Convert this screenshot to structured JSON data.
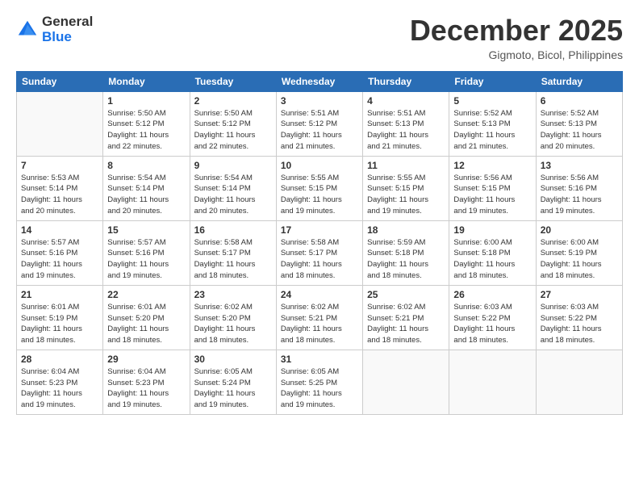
{
  "logo": {
    "general": "General",
    "blue": "Blue"
  },
  "title": "December 2025",
  "location": "Gigmoto, Bicol, Philippines",
  "weekdays": [
    "Sunday",
    "Monday",
    "Tuesday",
    "Wednesday",
    "Thursday",
    "Friday",
    "Saturday"
  ],
  "weeks": [
    [
      {
        "day": "",
        "info": ""
      },
      {
        "day": "1",
        "info": "Sunrise: 5:50 AM\nSunset: 5:12 PM\nDaylight: 11 hours\nand 22 minutes."
      },
      {
        "day": "2",
        "info": "Sunrise: 5:50 AM\nSunset: 5:12 PM\nDaylight: 11 hours\nand 22 minutes."
      },
      {
        "day": "3",
        "info": "Sunrise: 5:51 AM\nSunset: 5:12 PM\nDaylight: 11 hours\nand 21 minutes."
      },
      {
        "day": "4",
        "info": "Sunrise: 5:51 AM\nSunset: 5:13 PM\nDaylight: 11 hours\nand 21 minutes."
      },
      {
        "day": "5",
        "info": "Sunrise: 5:52 AM\nSunset: 5:13 PM\nDaylight: 11 hours\nand 21 minutes."
      },
      {
        "day": "6",
        "info": "Sunrise: 5:52 AM\nSunset: 5:13 PM\nDaylight: 11 hours\nand 20 minutes."
      }
    ],
    [
      {
        "day": "7",
        "info": "Sunrise: 5:53 AM\nSunset: 5:14 PM\nDaylight: 11 hours\nand 20 minutes."
      },
      {
        "day": "8",
        "info": "Sunrise: 5:54 AM\nSunset: 5:14 PM\nDaylight: 11 hours\nand 20 minutes."
      },
      {
        "day": "9",
        "info": "Sunrise: 5:54 AM\nSunset: 5:14 PM\nDaylight: 11 hours\nand 20 minutes."
      },
      {
        "day": "10",
        "info": "Sunrise: 5:55 AM\nSunset: 5:15 PM\nDaylight: 11 hours\nand 19 minutes."
      },
      {
        "day": "11",
        "info": "Sunrise: 5:55 AM\nSunset: 5:15 PM\nDaylight: 11 hours\nand 19 minutes."
      },
      {
        "day": "12",
        "info": "Sunrise: 5:56 AM\nSunset: 5:15 PM\nDaylight: 11 hours\nand 19 minutes."
      },
      {
        "day": "13",
        "info": "Sunrise: 5:56 AM\nSunset: 5:16 PM\nDaylight: 11 hours\nand 19 minutes."
      }
    ],
    [
      {
        "day": "14",
        "info": "Sunrise: 5:57 AM\nSunset: 5:16 PM\nDaylight: 11 hours\nand 19 minutes."
      },
      {
        "day": "15",
        "info": "Sunrise: 5:57 AM\nSunset: 5:16 PM\nDaylight: 11 hours\nand 19 minutes."
      },
      {
        "day": "16",
        "info": "Sunrise: 5:58 AM\nSunset: 5:17 PM\nDaylight: 11 hours\nand 18 minutes."
      },
      {
        "day": "17",
        "info": "Sunrise: 5:58 AM\nSunset: 5:17 PM\nDaylight: 11 hours\nand 18 minutes."
      },
      {
        "day": "18",
        "info": "Sunrise: 5:59 AM\nSunset: 5:18 PM\nDaylight: 11 hours\nand 18 minutes."
      },
      {
        "day": "19",
        "info": "Sunrise: 6:00 AM\nSunset: 5:18 PM\nDaylight: 11 hours\nand 18 minutes."
      },
      {
        "day": "20",
        "info": "Sunrise: 6:00 AM\nSunset: 5:19 PM\nDaylight: 11 hours\nand 18 minutes."
      }
    ],
    [
      {
        "day": "21",
        "info": "Sunrise: 6:01 AM\nSunset: 5:19 PM\nDaylight: 11 hours\nand 18 minutes."
      },
      {
        "day": "22",
        "info": "Sunrise: 6:01 AM\nSunset: 5:20 PM\nDaylight: 11 hours\nand 18 minutes."
      },
      {
        "day": "23",
        "info": "Sunrise: 6:02 AM\nSunset: 5:20 PM\nDaylight: 11 hours\nand 18 minutes."
      },
      {
        "day": "24",
        "info": "Sunrise: 6:02 AM\nSunset: 5:21 PM\nDaylight: 11 hours\nand 18 minutes."
      },
      {
        "day": "25",
        "info": "Sunrise: 6:02 AM\nSunset: 5:21 PM\nDaylight: 11 hours\nand 18 minutes."
      },
      {
        "day": "26",
        "info": "Sunrise: 6:03 AM\nSunset: 5:22 PM\nDaylight: 11 hours\nand 18 minutes."
      },
      {
        "day": "27",
        "info": "Sunrise: 6:03 AM\nSunset: 5:22 PM\nDaylight: 11 hours\nand 18 minutes."
      }
    ],
    [
      {
        "day": "28",
        "info": "Sunrise: 6:04 AM\nSunset: 5:23 PM\nDaylight: 11 hours\nand 19 minutes."
      },
      {
        "day": "29",
        "info": "Sunrise: 6:04 AM\nSunset: 5:23 PM\nDaylight: 11 hours\nand 19 minutes."
      },
      {
        "day": "30",
        "info": "Sunrise: 6:05 AM\nSunset: 5:24 PM\nDaylight: 11 hours\nand 19 minutes."
      },
      {
        "day": "31",
        "info": "Sunrise: 6:05 AM\nSunset: 5:25 PM\nDaylight: 11 hours\nand 19 minutes."
      },
      {
        "day": "",
        "info": ""
      },
      {
        "day": "",
        "info": ""
      },
      {
        "day": "",
        "info": ""
      }
    ]
  ]
}
